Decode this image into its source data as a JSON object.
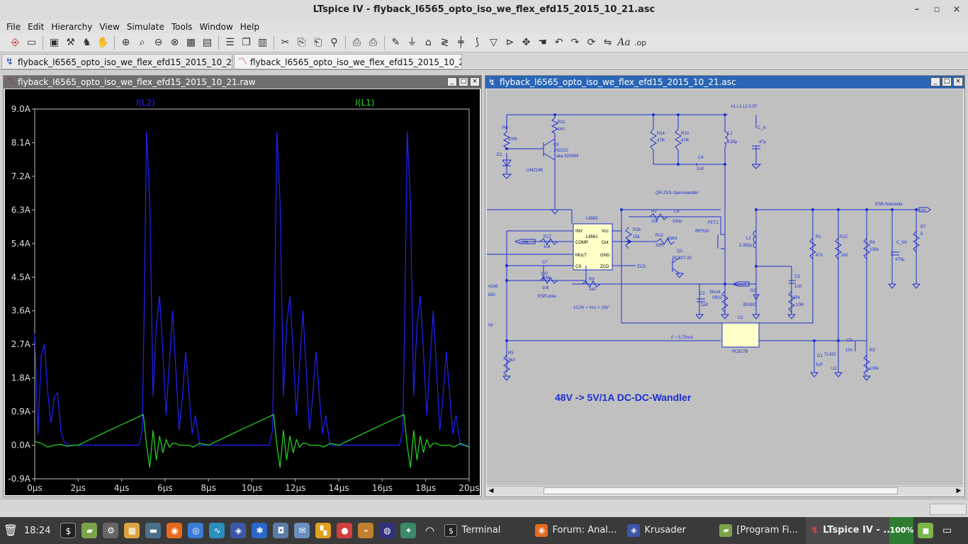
{
  "window_title": "LTspice IV - flyback_l6565_opto_iso_we_flex_efd15_2015_10_21.asc",
  "window_controls": [
    "–",
    "▫",
    "×"
  ],
  "menu": [
    "File",
    "Edit",
    "Hierarchy",
    "View",
    "Simulate",
    "Tools",
    "Window",
    "Help"
  ],
  "tabs": [
    {
      "label": "flyback_l6565_opto_iso_we_flex_efd15_2015_10_21.as",
      "icon": "schematic-icon"
    },
    {
      "label": "flyback_l6565_opto_iso_we_flex_efd15_2015_10_21.ra",
      "icon": "waveform-icon"
    }
  ],
  "plot_window": {
    "title": "flyback_l6565_opto_iso_we_flex_efd15_2015_10_21.raw",
    "title_bg": "#6e6e6e"
  },
  "schematic_window": {
    "title": "flyback_l6565_opto_iso_we_flex_efd15_2015_10_21.asc",
    "title_bg": "#2a66b5"
  },
  "chart_data": {
    "type": "line",
    "series": [
      {
        "name": "I(L2)",
        "color": "#2222ff",
        "x": [
          0,
          0.15,
          0.3,
          0.45,
          0.6,
          0.75,
          0.9,
          1.05,
          1.2,
          1.35,
          1.5,
          1.8,
          2.5,
          3.5,
          4.5,
          4.8,
          4.95,
          5.05,
          5.15,
          5.3,
          5.45,
          5.6,
          5.75,
          5.9,
          6.05,
          6.2,
          6.35,
          6.5,
          6.65,
          6.8,
          6.95,
          7.1,
          7.25,
          7.4,
          7.6,
          8,
          9.5,
          10.5,
          10.8,
          10.95,
          11.05,
          11.15,
          11.3,
          11.45,
          11.6,
          11.75,
          11.9,
          12.05,
          12.2,
          12.35,
          12.5,
          12.65,
          12.8,
          12.95,
          13.1,
          13.25,
          13.4,
          13.6,
          14,
          15.5,
          16.5,
          16.8,
          16.95,
          17.05,
          17.15,
          17.3,
          17.45,
          17.6,
          17.75,
          17.9,
          18.05,
          18.2,
          18.35,
          18.5,
          18.65,
          18.8,
          18.95,
          19.1,
          19.25,
          19.4,
          19.6,
          20
        ],
        "y": [
          3.0,
          0.3,
          2.4,
          2.7,
          1.4,
          0.6,
          1.3,
          1.4,
          0.4,
          0.1,
          0.0,
          0.0,
          0.0,
          0.0,
          0.0,
          0.0,
          0.4,
          4.0,
          8.4,
          6.5,
          1.3,
          3.2,
          4.0,
          2.5,
          0.8,
          2.2,
          3.6,
          2.0,
          0.4,
          1.3,
          2.5,
          1.4,
          0.3,
          0.8,
          0.0,
          0.0,
          0.0,
          0.0,
          0.0,
          0.4,
          4.0,
          8.4,
          6.5,
          1.3,
          3.2,
          4.0,
          2.5,
          0.8,
          2.2,
          3.6,
          2.0,
          0.4,
          1.3,
          2.5,
          1.4,
          0.3,
          0.8,
          0.0,
          0.0,
          0.0,
          0.0,
          0.0,
          0.4,
          4.0,
          8.4,
          6.5,
          1.3,
          3.2,
          4.0,
          2.5,
          0.8,
          2.2,
          3.6,
          2.0,
          0.4,
          1.3,
          2.5,
          1.4,
          0.3,
          0.8,
          0.0,
          0.0
        ]
      },
      {
        "name": "I(L1)",
        "color": "#22dd22",
        "x": [
          0,
          0.3,
          0.6,
          0.9,
          1.2,
          1.5,
          1.8,
          2,
          3,
          4,
          5,
          5.15,
          5.3,
          5.45,
          5.6,
          5.75,
          5.9,
          6.05,
          6.2,
          6.35,
          6.5,
          6.65,
          6.8,
          6.95,
          7.1,
          7.3,
          7.6,
          8,
          9,
          10,
          11,
          11.15,
          11.3,
          11.45,
          11.6,
          11.75,
          11.9,
          12.05,
          12.2,
          12.35,
          12.5,
          12.65,
          12.8,
          12.95,
          13.1,
          13.3,
          13.6,
          14,
          15,
          16,
          17,
          17.15,
          17.3,
          17.45,
          17.6,
          17.75,
          17.9,
          18.05,
          18.2,
          18.35,
          18.5,
          18.65,
          18.8,
          18.95,
          19.1,
          19.3,
          19.6,
          20
        ],
        "y": [
          0.1,
          0.05,
          -0.05,
          0.0,
          0.02,
          -0.03,
          0.0,
          0.0,
          0.28,
          0.55,
          0.82,
          0.0,
          -0.6,
          0.4,
          -0.4,
          0.25,
          -0.2,
          0.15,
          -0.05,
          0.05,
          0.05,
          0.0,
          0.0,
          0.0,
          0.0,
          -0.05,
          0.05,
          0.0,
          0.28,
          0.55,
          0.82,
          0.0,
          -0.6,
          0.4,
          -0.4,
          0.25,
          -0.2,
          0.15,
          -0.05,
          0.05,
          0.05,
          0.0,
          0.0,
          0.0,
          0.0,
          -0.05,
          0.05,
          0.0,
          0.28,
          0.55,
          0.82,
          0.0,
          -0.6,
          0.4,
          -0.4,
          0.25,
          -0.2,
          0.15,
          -0.05,
          0.05,
          0.05,
          0.0,
          0.0,
          0.0,
          0.0,
          -0.05,
          0.05,
          -0.05
        ]
      }
    ],
    "xlim": [
      0,
      20
    ],
    "ylim": [
      -0.9,
      9.0
    ],
    "yticks": [
      "9.0A",
      "8.1A",
      "7.2A",
      "6.3A",
      "5.4A",
      "4.5A",
      "3.6A",
      "2.7A",
      "1.8A",
      "0.9A",
      "0.0A",
      "-0.9A"
    ],
    "ytick_values": [
      9.0,
      8.1,
      7.2,
      6.3,
      5.4,
      4.5,
      3.6,
      2.7,
      1.8,
      0.9,
      0.0,
      -0.9
    ],
    "xticks": [
      "0µs",
      "2µs",
      "4µs",
      "6µs",
      "8µs",
      "10µs",
      "12µs",
      "14µs",
      "16µs",
      "18µs",
      "20µs"
    ],
    "xtick_values": [
      0,
      2,
      4,
      6,
      8,
      10,
      12,
      14,
      16,
      18,
      20
    ],
    "grid": false,
    "background": "#000000"
  },
  "schematic": {
    "heading": "48V -> 5V/1A DC-DC-Wandler",
    "coupling": "k1 L1 L2 0.97",
    "qr_label": "QR-ZVS-Sperrwandler",
    "esr_null": "ESR-Nullstelle",
    "esr_pole": "ESR-pole",
    "vcc_range": "10,3V < Vcc < 18V",
    "opto_current": "0 ~ 0,75mA",
    "ic_name": "L6565",
    "ic_part": "L6561",
    "ic_pins_left": [
      "INV",
      "COMP",
      "MULT",
      "CS"
    ],
    "ic_pins_right": [
      "Vcc",
      "Out",
      "GND",
      "ZCD"
    ],
    "labels": {
      "r8": "R8",
      "r8v": "100k",
      "r11": "R11",
      "r11v": "1k0",
      "q1": "Q1",
      "q1v": "2N2222",
      "q1note": "aka 620564",
      "d1": "D1",
      "umz": "UMZ18K",
      "r14": "R14",
      "r14v": "47R",
      "r10": "R10",
      "r10v": "47R",
      "l1": "L1",
      "l1v": "120µ",
      "c_in": "C_in",
      "c_inv": "47µ",
      "c4": "C4",
      "c4v": "1n0",
      "r2": "R2",
      "r2v": "15k",
      "c6": "C6",
      "c6v": "330p",
      "r16": "R16",
      "r16v": "15k",
      "r17": "R17",
      "r17v": "10k",
      "comp": "comp",
      "c7": "C7",
      "c7v": "1n0",
      "r8b": "R8b",
      "r8bv": "10k",
      "r9": "R9",
      "r9v": "1k0",
      "r12": "R12",
      "r12v": "33R",
      "gate": "gate1",
      "q2": "Q2",
      "q2v": "BC807-25",
      "zcd": "ZCD",
      "fet1": "FET1",
      "fetv": "IRF530",
      "l2": "L2",
      "l2v": "2.352µ",
      "source": "source1",
      "shunt": "Shunt",
      "shuntv": "0R22",
      "c2": "C2",
      "c2v": "1µ0",
      "d2": "D2",
      "d2v": "B530C",
      "c3": "C3",
      "c3v": "1n0",
      "r4": "R4",
      "r4v": "10R",
      "r1": "R1",
      "r1v": "470",
      "r12b": "R12",
      "r12bv": "1k0",
      "r6": "R6",
      "r6v": "100k",
      "cout": "C_5V",
      "coutv": "470µ",
      "r7": "R7",
      "r7v": "5",
      "out": "out",
      "u1": "U1",
      "u1v": "PC817B",
      "tl": "TL431",
      "u2": "U2",
      "c5": "C5",
      "c5v": "10n",
      "r3": "R3",
      "r3v": "100k",
      "c1": "C1",
      "c1v": "1µ0",
      "r5": "R5",
      "r5v": "3k3",
      "m4148": "4148",
      "k50": "k50",
      "up": "up"
    }
  },
  "taskbar": {
    "clock": "18:24",
    "tasks": [
      {
        "label": "Terminal",
        "color": "#333"
      },
      {
        "label": "Forum: Anal...",
        "color": "#e66a1d"
      },
      {
        "label": "Krusader",
        "color": "#3a57a8"
      },
      {
        "label": "[Program Fi...",
        "color": "#7ba34a"
      },
      {
        "label": "LTspice IV - ...",
        "color": "#c0392b"
      }
    ],
    "battery": "100%"
  }
}
